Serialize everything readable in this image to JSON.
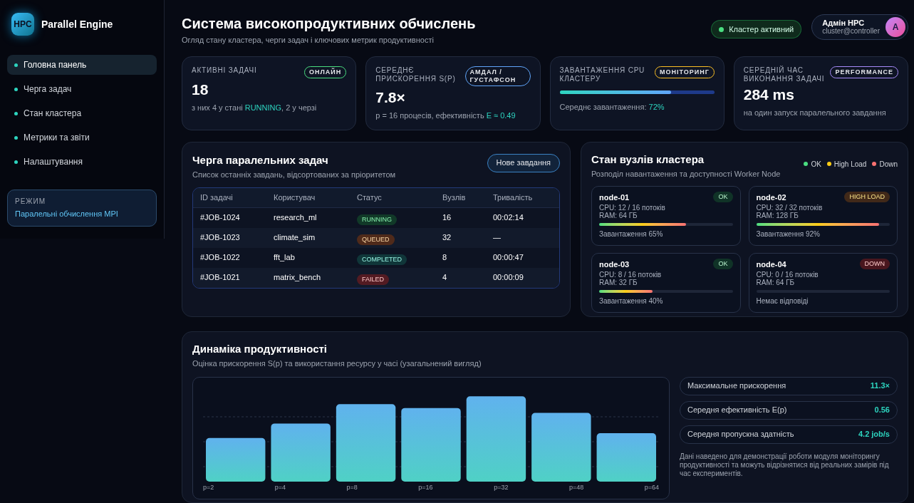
{
  "sidebar": {
    "logo": "HPC",
    "app_name": "Parallel Engine",
    "items": [
      {
        "label": "Головна панель",
        "selected": true
      },
      {
        "label": "Черга задач",
        "selected": false
      },
      {
        "label": "Стан кластера",
        "selected": false
      },
      {
        "label": "Метрики та звіти",
        "selected": false
      },
      {
        "label": "Налаштування",
        "selected": false
      }
    ],
    "mode": {
      "label": "РЕЖИМ",
      "value": "Паралельні обчислення MPI"
    }
  },
  "header": {
    "title": "Система високопродуктивних обчислень",
    "subtitle": "Огляд стану кластера, черги задач і ключових метрик продуктивності",
    "status": "Кластер активний",
    "user": {
      "name": "Адмін HPC",
      "email": "cluster@controller",
      "initial": "A"
    }
  },
  "stats": [
    {
      "kind": "value",
      "label": "АКТИВНІ ЗАДАЧІ",
      "badge": "ОНЛАЙН",
      "color": "#4ade80",
      "value": "18",
      "note": [
        {
          "text": "з них 4 у стані ",
          "hl": false
        },
        {
          "text": "RUNNING",
          "hl": true
        },
        {
          "text": ", 2 у черзі",
          "hl": false
        }
      ]
    },
    {
      "kind": "value",
      "label": "СЕРЕДНЄ ПРИСКОРЕННЯ S(P)",
      "badge": "АМДАЛ / ГУСТАФСОН",
      "color": "#60a5fa",
      "value": "7.8×",
      "note": [
        {
          "text": "p = 16 процесів, ефективність ",
          "hl": false
        },
        {
          "text": "E ≈ 0.49",
          "hl": true
        }
      ]
    },
    {
      "kind": "meter",
      "label": "ЗАВАНТАЖЕННЯ CPU КЛАСТЕРУ",
      "badge": "МОНІТОРИНГ",
      "color": "#fbbf24",
      "level": 0.72,
      "note": [
        {
          "text": "Середнє завантаження: ",
          "hl": false
        },
        {
          "text": "72%",
          "hl": true
        }
      ]
    },
    {
      "kind": "value",
      "label": "СЕРЕДНІЙ ЧАС ВИКОНАННЯ ЗАДАЧІ",
      "badge": "PERFORMANCE",
      "color": "#a78bfa",
      "value": "284 ms",
      "note": [
        {
          "text": "на один запуск паралельного завдання",
          "hl": false
        }
      ]
    }
  ],
  "queue": {
    "title": "Черга паралельних задач",
    "subtitle": "Список останніх завдань, відсортованих за пріоритетом",
    "button": "Нове завдання",
    "columns": [
      "ID задачі",
      "Користувач",
      "Статус",
      "Вузлів",
      "Тривалість"
    ],
    "rows": [
      {
        "id": "#JOB-1024",
        "user": "research_ml",
        "status": "RUNNING",
        "kind": "running",
        "nodes": "16",
        "duration": "00:02:14"
      },
      {
        "id": "#JOB-1023",
        "user": "climate_sim",
        "status": "QUEUED",
        "kind": "queued",
        "nodes": "32",
        "duration": "—"
      },
      {
        "id": "#JOB-1022",
        "user": "fft_lab",
        "status": "COMPLETED",
        "kind": "completed",
        "nodes": "8",
        "duration": "00:00:47"
      },
      {
        "id": "#JOB-1021",
        "user": "matrix_bench",
        "status": "FAILED",
        "kind": "failed",
        "nodes": "4",
        "duration": "00:00:09"
      }
    ]
  },
  "nodes": {
    "title": "Стан вузлів кластера",
    "subtitle": "Розподіл навантаження та доступності Worker Node",
    "legend": [
      {
        "label": "OK",
        "color": "#4ade80"
      },
      {
        "label": "High Load",
        "color": "#facc15"
      },
      {
        "label": "Down",
        "color": "#f87171"
      }
    ],
    "items": [
      {
        "name": "node-01",
        "badge": "OK",
        "kind": "ok",
        "cpu": "CPU: 12 / 16 потоків",
        "ram": "RAM: 64 ГБ",
        "level": 0.65,
        "note": "Завантаження 65%"
      },
      {
        "name": "node-02",
        "badge": "HIGH LOAD",
        "kind": "high",
        "cpu": "CPU: 32 / 32 потоків",
        "ram": "RAM: 128 ГБ",
        "level": 0.92,
        "note": "Завантаження 92%"
      },
      {
        "name": "node-03",
        "badge": "OK",
        "kind": "ok",
        "cpu": "CPU: 8 / 16 потоків",
        "ram": "RAM: 32 ГБ",
        "level": 0.4,
        "note": "Завантаження 40%"
      },
      {
        "name": "node-04",
        "badge": "DOWN",
        "kind": "down",
        "cpu": "CPU: 0 / 16 потоків",
        "ram": "RAM: 64 ГБ",
        "level": 0,
        "note": "Немає відповіді"
      }
    ]
  },
  "performance": {
    "title": "Динаміка продуктивності",
    "subtitle": "Оцінка прискорення S(p) та використання ресурсу у часі (узагальнений вигляд)",
    "x_labels": [
      "p=2",
      "p=4",
      "p=8",
      "p=16",
      "p=32",
      "p=48",
      "p=64"
    ],
    "metrics": [
      {
        "label": "Максимальне прискорення",
        "value": "11.3×"
      },
      {
        "label": "Середня ефективність E(p)",
        "value": "0.56"
      },
      {
        "label": "Середня пропускна здатність",
        "value": "4.2 job/s"
      }
    ],
    "note": "Дані наведено для демонстрації роботи модуля моніторингу продуктивності та можуть відрізнятися від реальних замірів під час експериментів."
  }
}
